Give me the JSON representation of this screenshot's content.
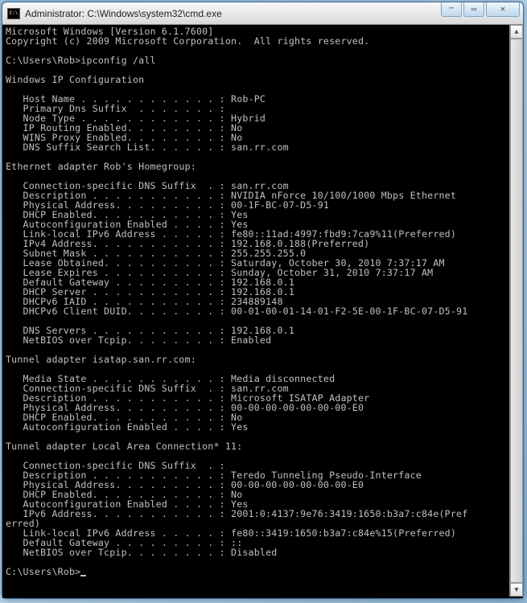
{
  "window": {
    "title": "Administrator: C:\\Windows\\system32\\cmd.exe"
  },
  "terminal": {
    "header1": "Microsoft Windows [Version 6.1.7600]",
    "header2": "Copyright (c) 2009 Microsoft Corporation.  All rights reserved.",
    "prompt1": "C:\\Users\\Rob>ipconfig /all",
    "section_winip": "Windows IP Configuration",
    "host_name": "   Host Name . . . . . . . . . . . . : Rob-PC",
    "primary_dns": "   Primary Dns Suffix  . . . . . . . :",
    "node_type": "   Node Type . . . . . . . . . . . . : Hybrid",
    "ip_routing": "   IP Routing Enabled. . . . . . . . : No",
    "wins_proxy": "   WINS Proxy Enabled. . . . . . . . : No",
    "dns_search": "   DNS Suffix Search List. . . . . . : san.rr.com",
    "section_eth": "Ethernet adapter Rob's Homegroup:",
    "eth_conn_dns": "   Connection-specific DNS Suffix  . : san.rr.com",
    "eth_desc": "   Description . . . . . . . . . . . : NVIDIA nForce 10/100/1000 Mbps Ethernet",
    "eth_phys": "   Physical Address. . . . . . . . . : 00-1F-BC-07-D5-91",
    "eth_dhcp": "   DHCP Enabled. . . . . . . . . . . : Yes",
    "eth_autoconf": "   Autoconfiguration Enabled . . . . : Yes",
    "eth_ll_ipv6": "   Link-local IPv6 Address . . . . . : fe80::11ad:4997:fbd9:7ca9%11(Preferred)",
    "eth_ipv4": "   IPv4 Address. . . . . . . . . . . : 192.168.0.188(Preferred)",
    "eth_subnet": "   Subnet Mask . . . . . . . . . . . : 255.255.255.0",
    "eth_lease_obt": "   Lease Obtained. . . . . . . . . . : Saturday, October 30, 2010 7:37:17 AM",
    "eth_lease_exp": "   Lease Expires . . . . . . . . . . : Sunday, October 31, 2010 7:37:17 AM",
    "eth_gateway": "   Default Gateway . . . . . . . . . : 192.168.0.1",
    "eth_dhcp_srv": "   DHCP Server . . . . . . . . . . . : 192.168.0.1",
    "eth_dhcpv6_iaid": "   DHCPv6 IAID . . . . . . . . . . . : 234889148",
    "eth_dhcpv6_duid": "   DHCPv6 Client DUID. . . . . . . . : 00-01-00-01-14-01-F2-5E-00-1F-BC-07-D5-91",
    "eth_dns_srv": "   DNS Servers . . . . . . . . . . . : 192.168.0.1",
    "eth_netbios": "   NetBIOS over Tcpip. . . . . . . . : Enabled",
    "section_isatap": "Tunnel adapter isatap.san.rr.com:",
    "isa_media": "   Media State . . . . . . . . . . . : Media disconnected",
    "isa_conn_dns": "   Connection-specific DNS Suffix  . : san.rr.com",
    "isa_desc": "   Description . . . . . . . . . . . : Microsoft ISATAP Adapter",
    "isa_phys": "   Physical Address. . . . . . . . . : 00-00-00-00-00-00-00-E0",
    "isa_dhcp": "   DHCP Enabled. . . . . . . . . . . : No",
    "isa_autoconf": "   Autoconfiguration Enabled . . . . : Yes",
    "section_lac": "Tunnel adapter Local Area Connection* 11:",
    "lac_conn_dns": "   Connection-specific DNS Suffix  . :",
    "lac_desc": "   Description . . . . . . . . . . . : Teredo Tunneling Pseudo-Interface",
    "lac_phys": "   Physical Address. . . . . . . . . : 00-00-00-00-00-00-00-E0",
    "lac_dhcp": "   DHCP Enabled. . . . . . . . . . . : No",
    "lac_autoconf": "   Autoconfiguration Enabled . . . . : Yes",
    "lac_ipv6_a": "   IPv6 Address. . . . . . . . . . . : 2001:0:4137:9e76:3419:1650:b3a7:c84e(Pref",
    "lac_ipv6_b": "erred)",
    "lac_ll_ipv6": "   Link-local IPv6 Address . . . . . : fe80::3419:1650:b3a7:c84e%15(Preferred)",
    "lac_gateway": "   Default Gateway . . . . . . . . . : ::",
    "lac_netbios": "   NetBIOS over Tcpip. . . . . . . . : Disabled",
    "prompt2": "C:\\Users\\Rob>"
  }
}
